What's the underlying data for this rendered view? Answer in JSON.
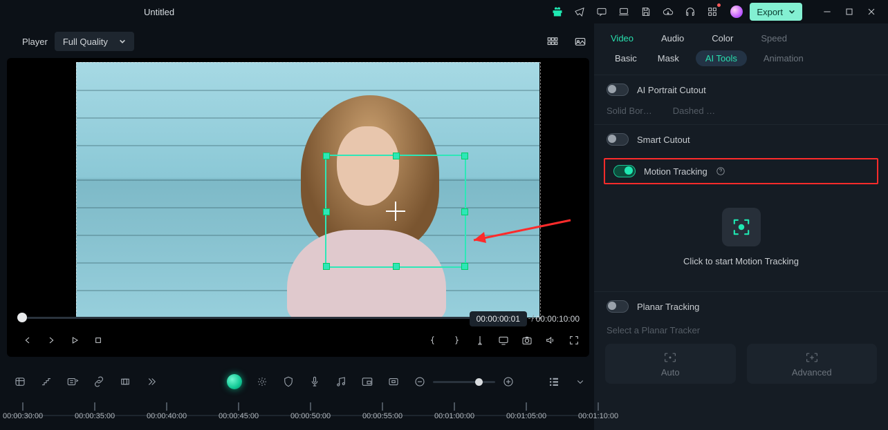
{
  "titlebar": {
    "title": "Untitled",
    "export_label": "Export"
  },
  "player": {
    "label": "Player",
    "quality": "Full Quality",
    "current_time": "00:00:00:01",
    "separator": "/",
    "total_time": "00:00:10:00"
  },
  "ruler": {
    "ticks": [
      "00:00:30:00",
      "00:00:35:00",
      "00:00:40:00",
      "00:00:45:00",
      "00:00:50:00",
      "00:00:55:00",
      "00:01:00:00",
      "00:01:05:00",
      "00:01:10:00"
    ]
  },
  "panel": {
    "tabs_primary": {
      "video": "Video",
      "audio": "Audio",
      "color": "Color",
      "speed": "Speed"
    },
    "tabs_secondary": {
      "basic": "Basic",
      "mask": "Mask",
      "aitools": "AI Tools",
      "animation": "Animation"
    },
    "portrait": {
      "label": "AI Portrait Cutout",
      "opt_a": "Solid Bor…",
      "opt_b": "Dashed …"
    },
    "smart_cutout": "Smart Cutout",
    "motion_tracking": "Motion Tracking",
    "start_tracking": "Click to start Motion Tracking",
    "planar_tracking": "Planar Tracking",
    "select_tracker": "Select a Planar Tracker",
    "tracker_auto": "Auto",
    "tracker_advanced": "Advanced"
  }
}
